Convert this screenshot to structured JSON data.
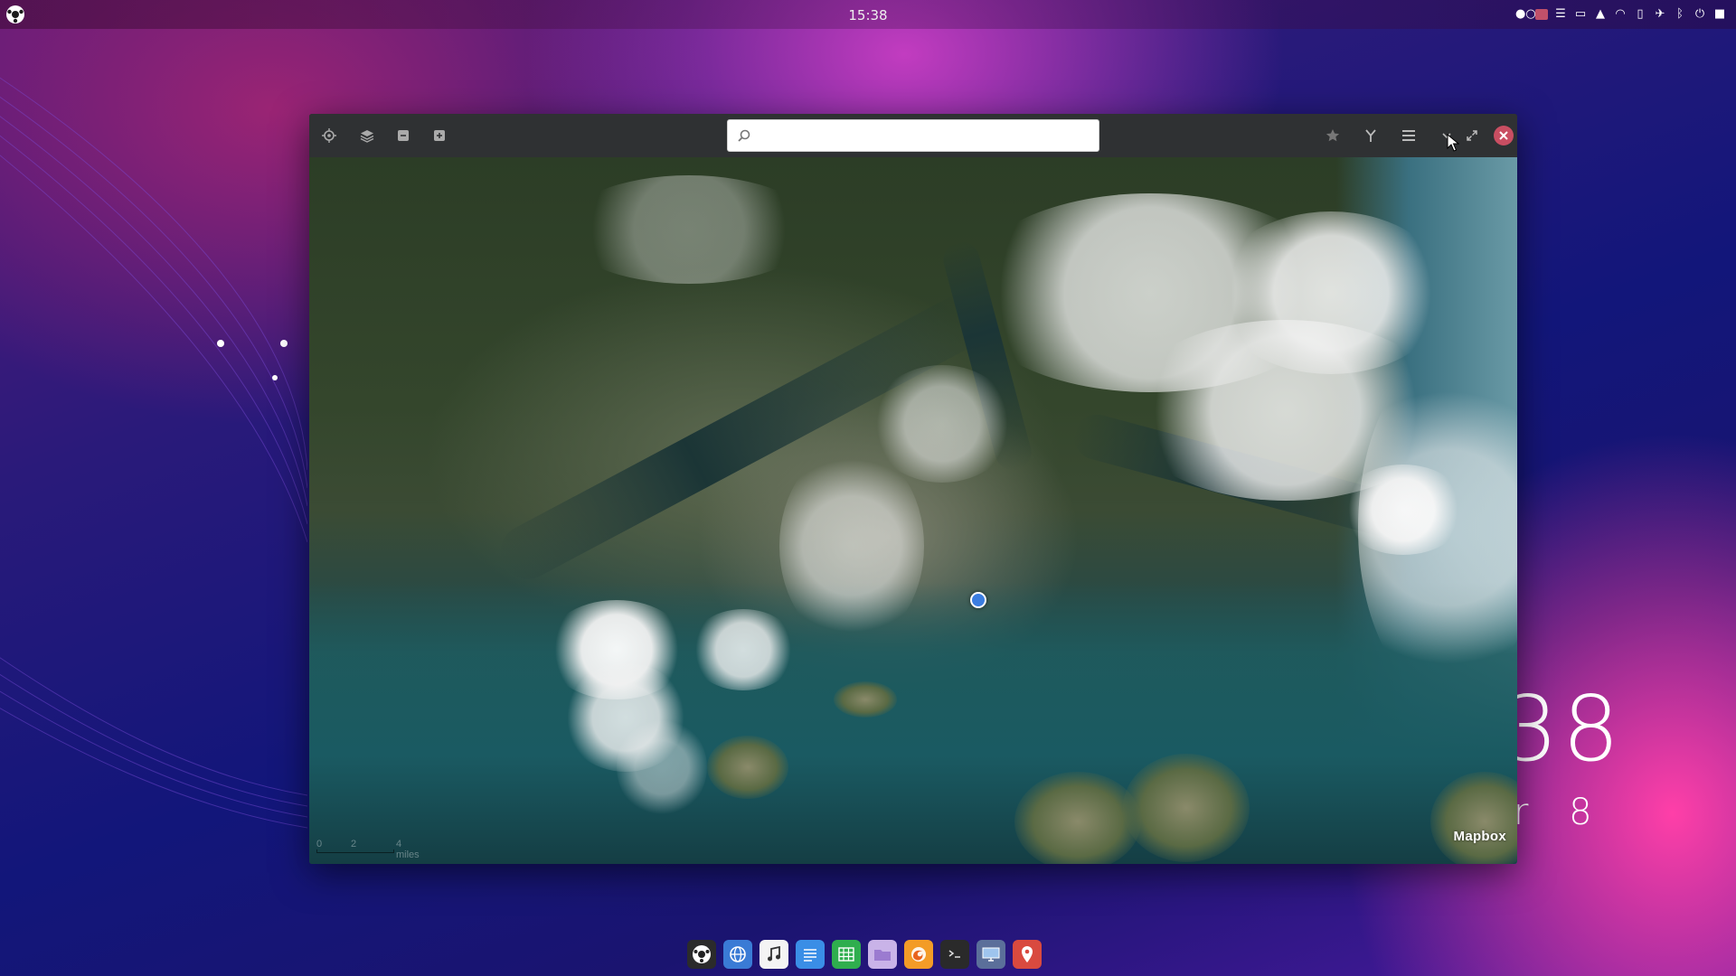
{
  "topbar": {
    "clock": "15:38",
    "logo_icon": "system-logo-icon",
    "tray_icons": [
      "indicator-dots-icon",
      "screen-recorder-icon",
      "menu-icon",
      "folder-icon",
      "notification-bell-icon",
      "wifi-icon",
      "battery-icon",
      "airplane-mode-icon",
      "bluetooth-icon",
      "power-icon",
      "desktop-icon"
    ]
  },
  "desktop_widget": {
    "time_fragment": "38",
    "date_fragment": "r  8"
  },
  "maps_window": {
    "toolbar": {
      "locate_icon": "locate-me-icon",
      "layers_icon": "layers-icon",
      "zoom_out_icon": "zoom-out-icon",
      "zoom_in_icon": "zoom-in-icon",
      "search_placeholder": "",
      "search_value": "",
      "favorites_icon": "star-icon",
      "routes_icon": "route-icon",
      "menu_icon": "hamburger-menu-icon",
      "minimize_icon": "minimize-icon",
      "maximize_icon": "maximize-icon",
      "close_icon": "close-icon"
    },
    "map": {
      "attribution": "Mapbox",
      "scale_labels": [
        "0",
        "2",
        "4 miles"
      ],
      "location_marker": "current-location-icon"
    },
    "colors": {
      "headerbar": "#2f3133",
      "close_button": "#c94e62",
      "marker": "#3b7de0"
    }
  },
  "dock": {
    "items": [
      {
        "name": "system-settings",
        "icon": "soccer-logo-icon",
        "color": "#2b2b2b"
      },
      {
        "name": "browser",
        "icon": "globe-icon",
        "color": "#3a7bd5"
      },
      {
        "name": "music",
        "icon": "music-note-icon",
        "color": "#f4f4f4"
      },
      {
        "name": "text-editor",
        "icon": "document-lines-icon",
        "color": "#3a8ee6"
      },
      {
        "name": "spreadsheet",
        "icon": "grid-icon",
        "color": "#2fae4e"
      },
      {
        "name": "files",
        "icon": "folder-icon",
        "color": "#c9b3e8"
      },
      {
        "name": "firefox",
        "icon": "firefox-icon",
        "color": "#f39c27"
      },
      {
        "name": "terminal",
        "icon": "terminal-icon",
        "color": "#2a2a2a"
      },
      {
        "name": "screenshot-tool",
        "icon": "monitor-icon",
        "color": "#5b6f9a"
      },
      {
        "name": "maps",
        "icon": "map-pin-icon",
        "color": "#d94a3f"
      }
    ]
  }
}
